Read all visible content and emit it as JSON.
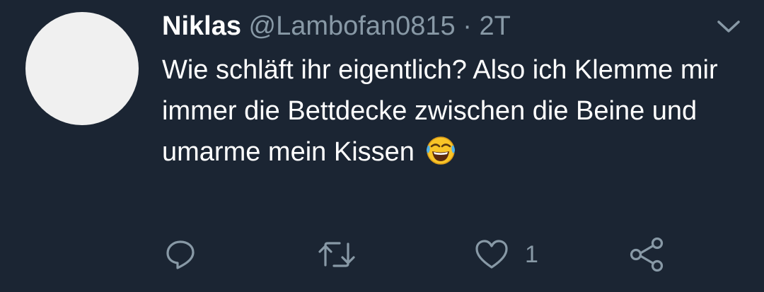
{
  "tweet": {
    "author_name": "Niklas",
    "handle": "@Lambofan0815",
    "separator": "·",
    "time": "2T",
    "text": "Wie schläft ihr eigentlich? Also ich Klemme mir immer die Bettdecke zwischen die Beine und umarme mein Kissen",
    "emoji": "face-with-tears-of-joy"
  },
  "actions": {
    "reply_icon": "reply-icon",
    "retweet_icon": "retweet-icon",
    "like_icon": "heart-icon",
    "like_count": "1",
    "share_icon": "share-icon"
  },
  "colors": {
    "background": "#1b2533",
    "primary_text": "#ffffff",
    "secondary_text": "#8899a6",
    "avatar": "#f0f0f0"
  }
}
